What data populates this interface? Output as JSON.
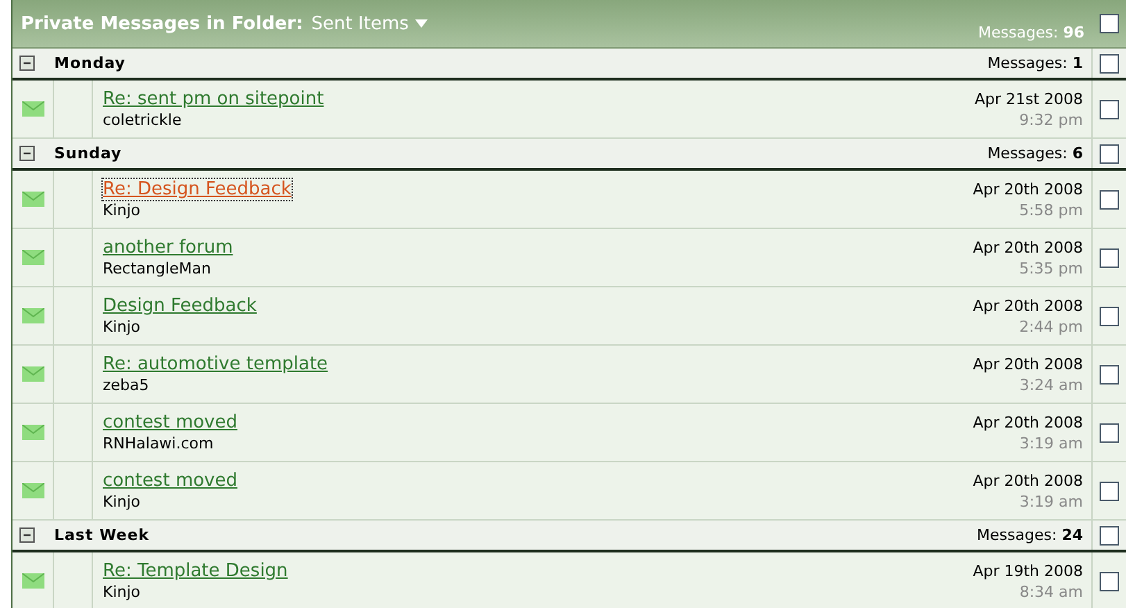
{
  "header": {
    "title": "Private Messages in Folder:",
    "folder": "Sent Items",
    "count_label": "Messages:",
    "count": "96",
    "checked": false
  },
  "groups": [
    {
      "title": "Monday",
      "count_label": "Messages:",
      "count": "1",
      "expanded": true,
      "checked": false,
      "messages": [
        {
          "subject": "Re: sent pm on sitepoint",
          "recipient": "coletrickle",
          "date": "Apr 21st 2008",
          "time": "9:32 pm",
          "focused": false,
          "checked": false
        }
      ]
    },
    {
      "title": "Sunday",
      "count_label": "Messages:",
      "count": "6",
      "expanded": true,
      "checked": false,
      "messages": [
        {
          "subject": "Re: Design Feedback",
          "recipient": "Kinjo",
          "date": "Apr 20th 2008",
          "time": "5:58 pm",
          "focused": true,
          "checked": false
        },
        {
          "subject": "another forum",
          "recipient": "RectangleMan",
          "date": "Apr 20th 2008",
          "time": "5:35 pm",
          "focused": false,
          "checked": false
        },
        {
          "subject": "Design Feedback",
          "recipient": "Kinjo",
          "date": "Apr 20th 2008",
          "time": "2:44 pm",
          "focused": false,
          "checked": false
        },
        {
          "subject": "Re: automotive template",
          "recipient": "zeba5",
          "date": "Apr 20th 2008",
          "time": "3:24 am",
          "focused": false,
          "checked": false
        },
        {
          "subject": "contest moved",
          "recipient": "RNHalawi.com",
          "date": "Apr 20th 2008",
          "time": "3:19 am",
          "focused": false,
          "checked": false
        },
        {
          "subject": "contest moved",
          "recipient": "Kinjo",
          "date": "Apr 20th 2008",
          "time": "3:19 am",
          "focused": false,
          "checked": false
        }
      ]
    },
    {
      "title": "Last Week",
      "count_label": "Messages:",
      "count": "24",
      "expanded": true,
      "checked": false,
      "messages": [
        {
          "subject": "Re: Template Design",
          "recipient": "Kinjo",
          "date": "Apr 19th 2008",
          "time": "8:34 am",
          "focused": false,
          "checked": false
        }
      ]
    }
  ]
}
